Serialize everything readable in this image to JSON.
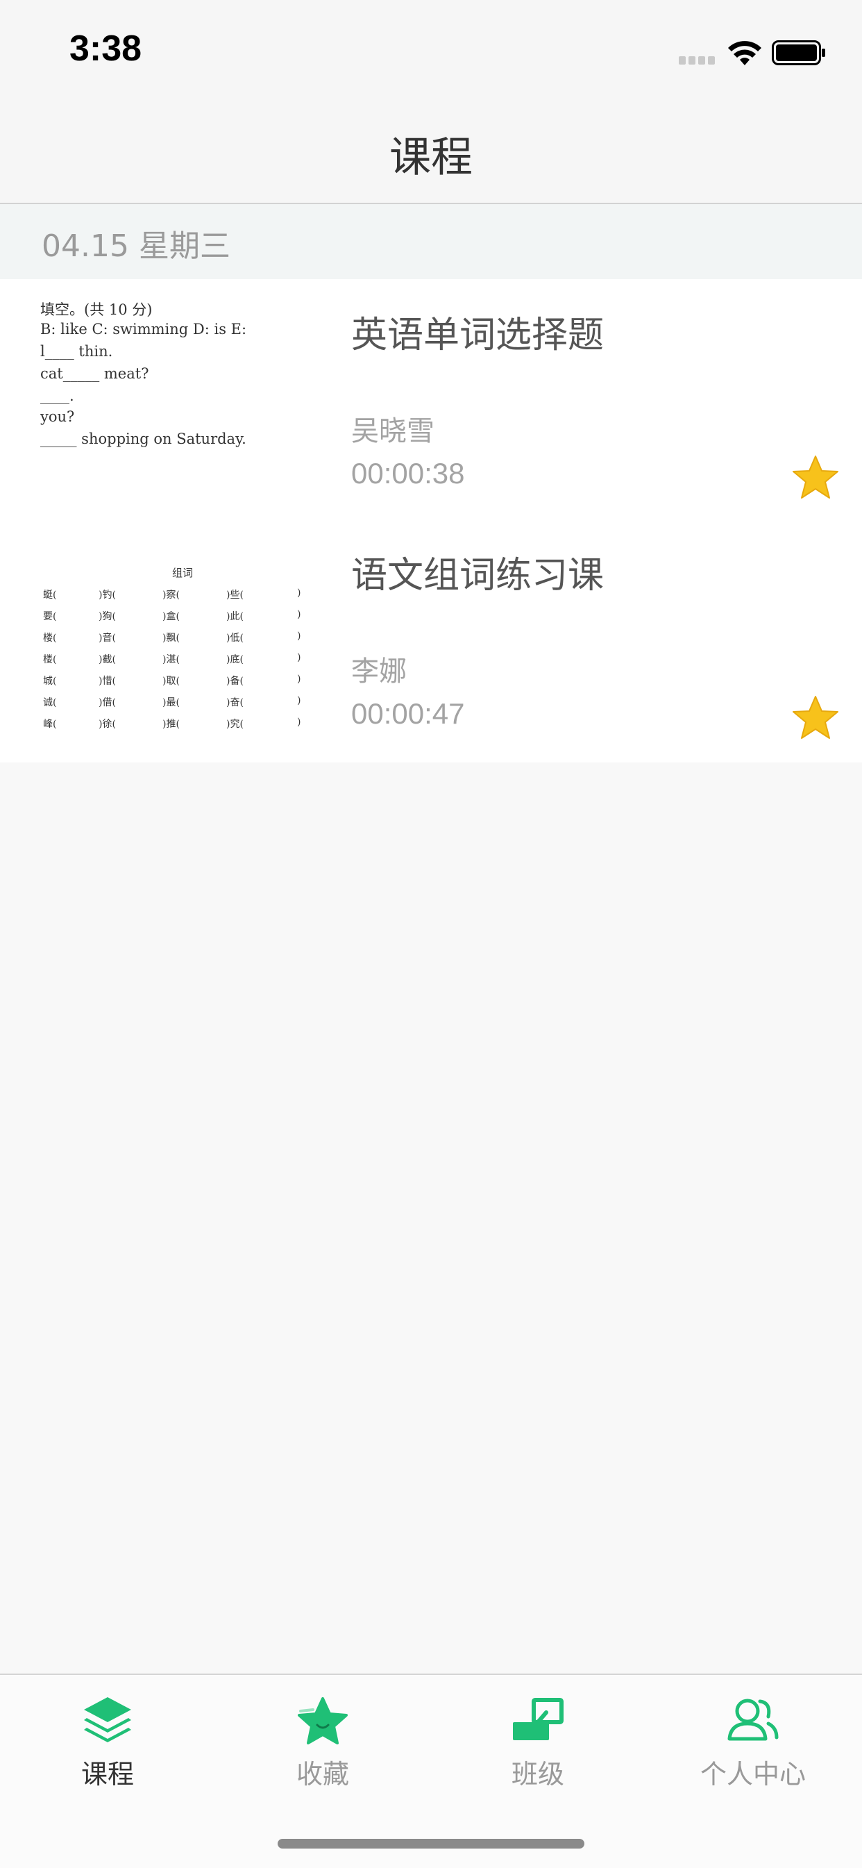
{
  "status_bar": {
    "time": "3:38"
  },
  "header": {
    "title": "课程"
  },
  "date_section": {
    "label": "04.15 星期三"
  },
  "courses": [
    {
      "title": "英语单词选择题",
      "author": "吴晓雪",
      "duration": "00:00:38",
      "favorited": true,
      "thumbnail_lines": [
        "填空。(共 10 分)",
        "   B: like   C: swimming   D: is   E:",
        "l____ thin.",
        " cat_____ meat?",
        "____.",
        "you?",
        "_____ shopping on Saturday."
      ]
    },
    {
      "title": "语文组词练习课",
      "author": "李娜",
      "duration": "00:00:47",
      "favorited": true,
      "thumbnail_title": "组词",
      "thumbnail_rows": [
        [
          "蜓(",
          ")钓(",
          ")察(",
          ")些(",
          ")"
        ],
        [
          "要(",
          ")狗(",
          ")盒(",
          ")此(",
          ")"
        ],
        [
          "楼(",
          ")音(",
          ")飘(",
          ")低(",
          ")"
        ],
        [
          "楼(",
          ")截(",
          ")湛(",
          ")底(",
          ")"
        ],
        [
          "城(",
          ")惜(",
          ")取(",
          ")备(",
          ")"
        ],
        [
          "诚(",
          ")借(",
          ")最(",
          ")奋(",
          ")"
        ],
        [
          "峰(",
          ")徐(",
          ")推(",
          ")究(",
          ")"
        ]
      ]
    }
  ],
  "tab_bar": {
    "tabs": [
      {
        "label": "课程",
        "icon": "layers-icon",
        "active": true
      },
      {
        "label": "收藏",
        "icon": "star-icon",
        "active": false
      },
      {
        "label": "班级",
        "icon": "classroom-icon",
        "active": false
      },
      {
        "label": "个人中心",
        "icon": "users-icon",
        "active": false
      }
    ]
  },
  "colors": {
    "accent": "#1fbf76",
    "star": "#f7c21b"
  }
}
